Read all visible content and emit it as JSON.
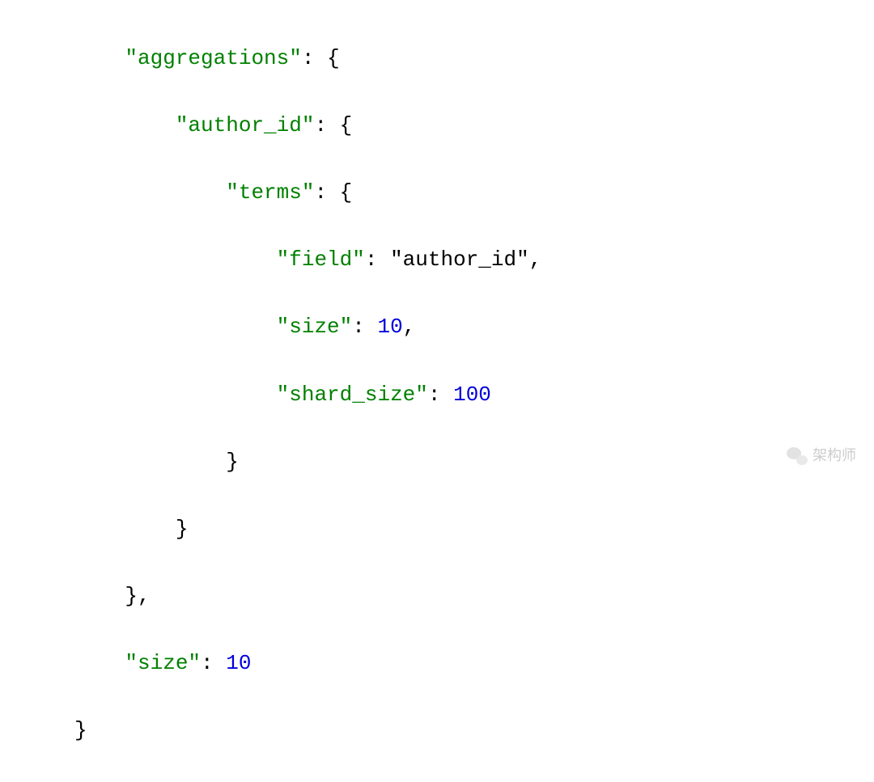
{
  "code": {
    "indent1": "    ",
    "indent2": "        ",
    "indent3": "            ",
    "indent4": "                ",
    "key_aggregations": "\"aggregations\"",
    "colon_brace": ": {",
    "key_author_id": "\"author_id\"",
    "key_terms": "\"terms\"",
    "key_field": "\"field\"",
    "val_field": "\"author_id\"",
    "key_size": "\"size\"",
    "val_size": "10",
    "key_shard_size": "\"shard_size\"",
    "val_shard_size": "100",
    "close_brace": "}",
    "close_brace_comma": "},",
    "comma": ",",
    "colon": ": "
  },
  "watermark": {
    "text": "架构师"
  }
}
